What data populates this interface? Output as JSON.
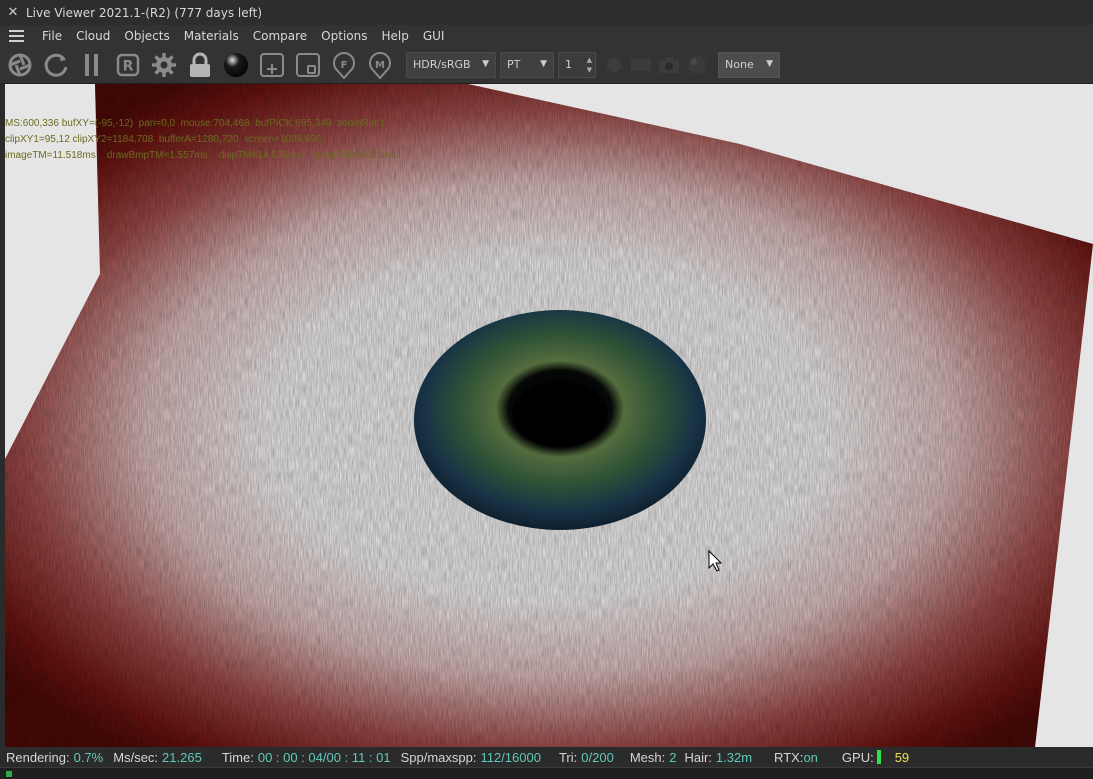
{
  "window": {
    "title": "Live Viewer 2021.1-(R2) (777 days left)"
  },
  "menu": [
    "File",
    "Cloud",
    "Objects",
    "Materials",
    "Compare",
    "Options",
    "Help",
    "GUI"
  ],
  "toolbar": {
    "tonemap": "HDR/sRGB",
    "kernel": "PT",
    "layer_value": "1",
    "compare": "None"
  },
  "overlay": {
    "line1": "MS:600,336 bufXY=(-95,-12)  pan=0,0  mouse:704,468  bufPICK:695,348  zoomRat:1",
    "line2": "clipXY1=95,12 clipXY2=1184,708  bufferA=1280,720  screen=1089,696",
    "line3": "imageTM=11.518ms.   drawBmpTM=1.557ms.   dispTM=14.536ms.   compTM=0.001ms."
  },
  "status": {
    "rendering_label": "Rendering:",
    "rendering_value": "0.7%",
    "mssec_label": "Ms/sec:",
    "mssec_value": "21.265",
    "time_label": "Time:",
    "time_value": "00 : 00 : 04/00 : 11 : 01",
    "spp_label": "Spp/maxspp:",
    "spp_value": "112/16000",
    "tri_label": "Tri:",
    "tri_value": "0/200",
    "mesh_label": "Mesh:",
    "mesh_value": "2",
    "hair_label": "Hair:",
    "hair_value": "1.32m",
    "rtx_label": "RTX:",
    "rtx_value": "on",
    "gpu_label": "GPU:",
    "gpu_value": "59"
  },
  "colors": {
    "background": "#e5e5e5",
    "status_value": "#5fc9b9",
    "gpu_bar": "#31e14b",
    "gpu_value": "#e8e35a",
    "overlay_text": "#6b6b20"
  }
}
